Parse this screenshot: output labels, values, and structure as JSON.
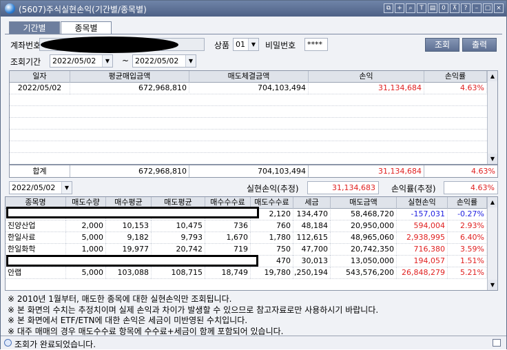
{
  "window": {
    "title": "(5607)주식실현손익(기간별/종목별)"
  },
  "tabs": [
    {
      "label": "기간별"
    },
    {
      "label": "종목별"
    }
  ],
  "filters": {
    "account_label": "계좌번호",
    "product_label": "상품",
    "product_value": "01",
    "password_label": "비밀번호",
    "password_value": "****",
    "period_label": "조회기간",
    "start_date": "2022/05/02",
    "tilde": "~",
    "end_date": "2022/05/02"
  },
  "buttons": {
    "search": "조회",
    "print": "출력"
  },
  "period_table": {
    "headers": [
      "일자",
      "평균매입금액",
      "매도체결금액",
      "손익",
      "손익률"
    ],
    "rows": [
      {
        "date": "2022/05/02",
        "avg_buy": "672,968,810",
        "sell": "704,103,494",
        "pnl": "31,134,684",
        "rate": "4.63%"
      }
    ]
  },
  "period_total": {
    "label": "합계",
    "avg_buy": "672,968,810",
    "sell": "704,103,494",
    "pnl": "31,134,684",
    "rate": "4.63%"
  },
  "detail_filter": {
    "date": "2022/05/02",
    "realized_label": "실현손익(추정)",
    "realized_value": "31,134,683",
    "rate_label": "손익률(추정)",
    "rate_value": "4.63%"
  },
  "stock_table": {
    "headers": [
      "종목명",
      "매도수량",
      "매수평균",
      "매도평균",
      "매수수수료",
      "매도수수료",
      "세금",
      "매도금액",
      "실현손익",
      "손익률"
    ],
    "rows": [
      {
        "name": "",
        "qty": "",
        "buy_avg": "",
        "sell_avg": "",
        "buy_fee": "",
        "sell_fee": "2,120",
        "tax": "134,470",
        "sell_amt": "58,468,720",
        "pnl": "-157,031",
        "rate": "-0.27%",
        "neg": true
      },
      {
        "name": "진양산업",
        "qty": "2,000",
        "buy_avg": "10,153",
        "sell_avg": "10,475",
        "buy_fee": "736",
        "sell_fee": "760",
        "tax": "48,184",
        "sell_amt": "20,950,000",
        "pnl": "594,004",
        "rate": "2.93%",
        "neg": false
      },
      {
        "name": "한일사료",
        "qty": "5,000",
        "buy_avg": "9,182",
        "sell_avg": "9,793",
        "buy_fee": "1,670",
        "sell_fee": "1,780",
        "tax": "112,615",
        "sell_amt": "48,965,060",
        "pnl": "2,938,995",
        "rate": "6.40%",
        "neg": false
      },
      {
        "name": "한일화학",
        "qty": "1,000",
        "buy_avg": "19,977",
        "sell_avg": "20,742",
        "buy_fee": "719",
        "sell_fee": "750",
        "tax": "47,700",
        "sell_amt": "20,742,350",
        "pnl": "716,380",
        "rate": "3.59%",
        "neg": false
      },
      {
        "name": "",
        "qty": "",
        "buy_avg": "",
        "sell_avg": "",
        "buy_fee": "",
        "sell_fee": "470",
        "tax": "30,013",
        "sell_amt": "13,050,000",
        "pnl": "194,057",
        "rate": "1.51%",
        "neg": false
      },
      {
        "name": "안랩",
        "qty": "5,000",
        "buy_avg": "103,088",
        "sell_avg": "108,715",
        "buy_fee": "18,749",
        "sell_fee": "19,780",
        "tax": ",250,194",
        "sell_amt": "543,576,200",
        "pnl": "26,848,279",
        "rate": "5.21%",
        "neg": false
      }
    ]
  },
  "notes": [
    "※ 2010년 1월부터, 매도한 종목에 대한 실현손익만 조회됩니다.",
    "※ 본 화면의 수치는 추정치이며 실제 손익과 차이가 발생할 수 있으므로 참고자료로만 사용하시기 바랍니다.",
    "※ 본 화면에서 ETF/ETN에 대한 손익은 세금이 미반영된 수치입니다.",
    "※ 대주 매매의 경우 매도수수료 항목에 수수료+세금이 함께 포함되어 있습니다."
  ],
  "status": {
    "message": "조회가 완료되었습니다."
  },
  "colors": {
    "positive": "#e02020",
    "negative": "#2020e0",
    "title_bar": "#5b6f94"
  }
}
